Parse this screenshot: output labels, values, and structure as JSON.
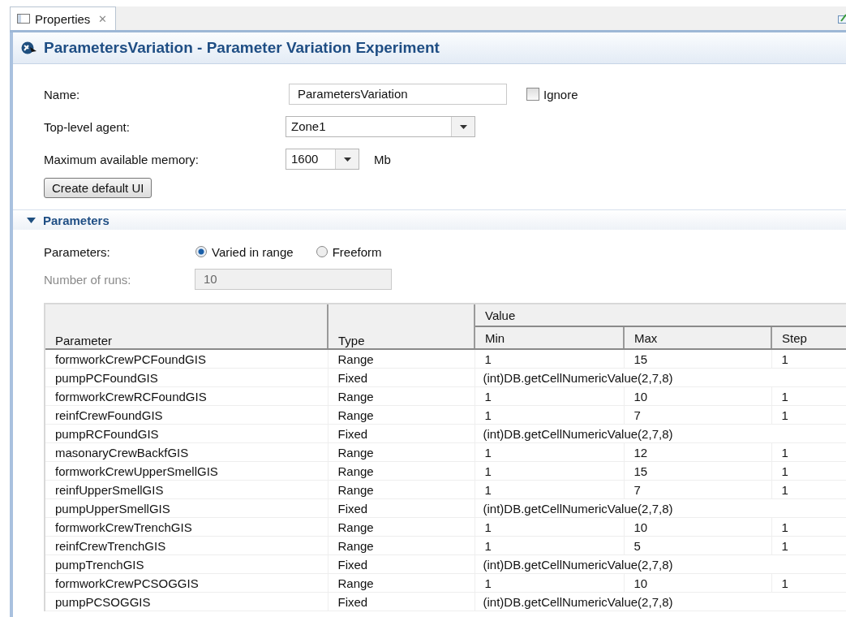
{
  "tab": {
    "label": "Properties",
    "close": "✕",
    "selected": true
  },
  "header": {
    "title": "ParametersVariation - Parameter Variation Experiment"
  },
  "form": {
    "name_label": "Name:",
    "name_value": "ParametersVariation",
    "ignore": {
      "label": "Ignore",
      "checked": false
    },
    "agent_label": "Top-level agent:",
    "agent_value": "Zone1",
    "memory_label": "Maximum available memory:",
    "memory_value": "1600",
    "memory_unit": "Mb",
    "button": "Create default UI"
  },
  "section": {
    "title": "Parameters",
    "expanded": true,
    "mode_label": "Parameters:",
    "modes": [
      {
        "label": "Varied in range",
        "selected": true
      },
      {
        "label": "Freeform",
        "selected": false
      }
    ],
    "runs_label": "Number of runs:",
    "runs_value": "10",
    "runs_disabled": true
  },
  "table": {
    "columns": {
      "parameter": "Parameter",
      "type": "Type",
      "value": "Value",
      "min": "Min",
      "max": "Max",
      "step": "Step"
    },
    "rows": [
      {
        "kind": "range",
        "parameter": "formworkCrewPCFoundGIS",
        "type": "Range",
        "min": "1",
        "max": "15",
        "step": "1"
      },
      {
        "kind": "fixed",
        "parameter": "pumpPCFoundGIS",
        "type": "Fixed",
        "expression": "(int)DB.getCellNumericValue(2,7,8)"
      },
      {
        "kind": "range",
        "parameter": "formworkCrewRCFoundGIS",
        "type": "Range",
        "min": "1",
        "max": "10",
        "step": "1"
      },
      {
        "kind": "range",
        "parameter": "reinfCrewFoundGIS",
        "type": "Range",
        "min": "1",
        "max": "7",
        "step": "1"
      },
      {
        "kind": "fixed",
        "parameter": "pumpRCFoundGIS",
        "type": "Fixed",
        "expression": "(int)DB.getCellNumericValue(2,7,8)"
      },
      {
        "kind": "range",
        "parameter": "masonaryCrewBackfGIS",
        "type": "Range",
        "min": "1",
        "max": "12",
        "step": "1"
      },
      {
        "kind": "range",
        "parameter": "formworkCrewUpperSmellGIS",
        "type": "Range",
        "min": "1",
        "max": "15",
        "step": "1"
      },
      {
        "kind": "range",
        "parameter": "reinfUpperSmellGIS",
        "type": "Range",
        "min": "1",
        "max": "7",
        "step": "1"
      },
      {
        "kind": "fixed",
        "parameter": "pumpUpperSmellGIS",
        "type": "Fixed",
        "expression": "(int)DB.getCellNumericValue(2,7,8)"
      },
      {
        "kind": "range",
        "parameter": "formworkCrewTrenchGIS",
        "type": "Range",
        "min": "1",
        "max": "10",
        "step": "1"
      },
      {
        "kind": "range",
        "parameter": "reinfCrewTrenchGIS",
        "type": "Range",
        "min": "1",
        "max": "5",
        "step": "1"
      },
      {
        "kind": "fixed",
        "parameter": "pumpTrenchGIS",
        "type": "Fixed",
        "expression": "(int)DB.getCellNumericValue(2,7,8)"
      },
      {
        "kind": "range",
        "parameter": "formworkCrewPCSOGGIS",
        "type": "Range",
        "min": "1",
        "max": "10",
        "step": "1"
      },
      {
        "kind": "fixed",
        "parameter": "pumpPCSOGGIS",
        "type": "Fixed",
        "expression": "(int)DB.getCellNumericValue(2,7,8)"
      }
    ]
  }
}
